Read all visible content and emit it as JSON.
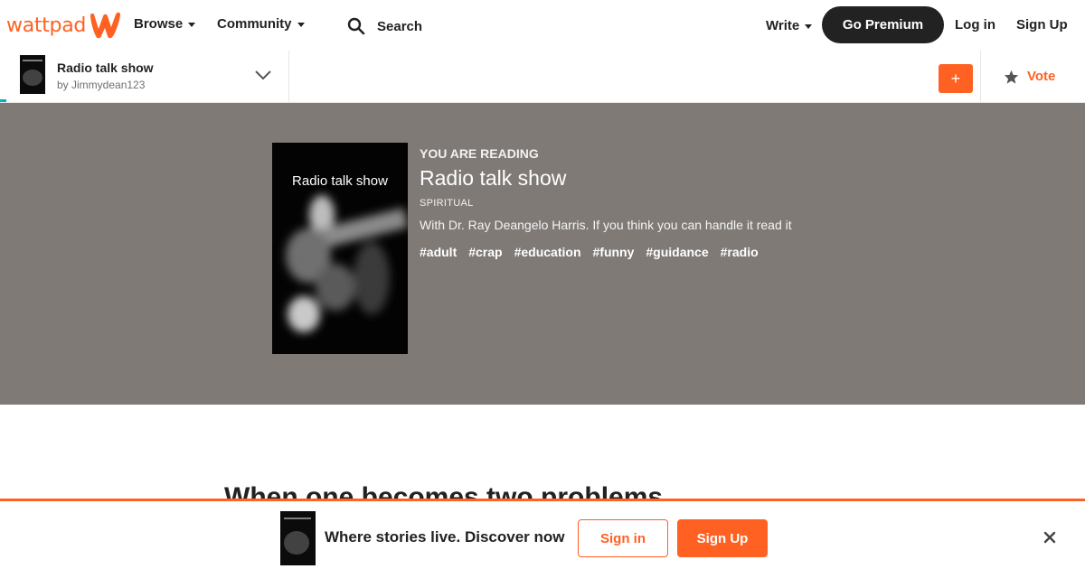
{
  "nav": {
    "logo_text": "wattpad",
    "browse_label": "Browse",
    "community_label": "Community",
    "search_placeholder": "Search",
    "write_label": "Write",
    "premium_label": "Go Premium",
    "login_label": "Log in",
    "signup_label": "Sign Up"
  },
  "storybar": {
    "title": "Radio talk show",
    "author": "by Jimmydean123",
    "add_label": "+",
    "vote_label": "Vote"
  },
  "story": {
    "cover_title": "Radio talk show",
    "reading_label": "YOU ARE READING",
    "title": "Radio talk show",
    "category": "SPIRITUAL",
    "description": "With Dr. Ray Deangelo Harris. If you think you can handle it read it",
    "tags": [
      "#adult",
      "#crap",
      "#education",
      "#funny",
      "#guidance",
      "#radio"
    ]
  },
  "chapter": {
    "heading": "When one becomes two problems"
  },
  "banner": {
    "text": "Where stories live. Discover now",
    "signin_label": "Sign in",
    "signup_label": "Sign Up"
  },
  "colors": {
    "brand": "#ff6122",
    "hero_bg": "#7f7a76",
    "dark_button": "#222222",
    "progress": "#00b2b2"
  },
  "icons": [
    "wattpad-w-icon",
    "caret-down-icon",
    "search-icon",
    "chevron-down-icon",
    "star-icon",
    "close-icon"
  ]
}
